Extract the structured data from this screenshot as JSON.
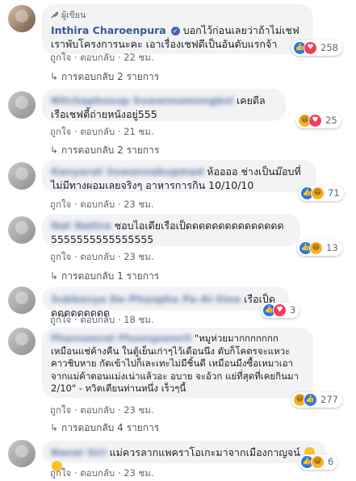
{
  "comments": [
    {
      "badge": "ผู้เขียน",
      "name": "Inthira Charoenpura",
      "text": "บอกไว้ก่อนเลยว่าถ้าไม่เชฟเราพับโครงการนะคะ เอาเรื่องเชฟดีเป็นอันดับแรกจ้า",
      "reactions": [
        "like",
        "love"
      ],
      "count": "258",
      "like_label": "ถูกใจ",
      "reply_label": "ตอบกลับ",
      "time": "22 ชม.",
      "replies_label": "การตอบกลับ 2 รายการ"
    },
    {
      "name": "Nitchaphosup Suwannamongkol",
      "text": "เคยดีลเรือเชฟตี้ถ่ายหนังอยู่555",
      "reactions": [
        "haha",
        "love"
      ],
      "count": "25",
      "like_label": "ถูกใจ",
      "reply_label": "ตอบกลับ",
      "time": "21 ชม.",
      "replies_label": "การตอบกลับ 2 รายการ"
    },
    {
      "name": "Kanyarat Suwannakupmad",
      "text": "ห้ออออ ช่างเป็นม๊อบที่ไม่มีทางผอมเลยจริงๆ อาหารการกิน 10/10/10",
      "reactions": [
        "like",
        "haha"
      ],
      "count": "71",
      "like_label": "ถูกใจ",
      "reply_label": "ตอบกลับ",
      "time": "23 ชม."
    },
    {
      "name": "Nat Nattra",
      "text": "ชอบไอเดียเรือเป็ดดดดดดดดดดดดดดด 5555555555555555",
      "reactions": [
        "like",
        "haha"
      ],
      "count": "13",
      "like_label": "ถูกใจ",
      "reply_label": "ตอบกลับ",
      "time": "23 ชม.",
      "replies_label": "การตอบกลับ 1 รายการ"
    },
    {
      "name": "Sukkanya De-Phanpha Pa-Ai-Sine",
      "text": "เรือเป็ดดดดดดดดดด",
      "reactions": [
        "like",
        "love"
      ],
      "count": "3",
      "like_label": "ถูกใจ",
      "reply_label": "ตอบกลับ",
      "time": "18 ชม."
    },
    {
      "name": "Phannamrat Phuengsamrit",
      "text": "\"หมูห่วยมากกกกกกก เหมือนแช่ค้างคืน ในตู้เย็นเก่าๆไว้เดือนนึง ตับก็โคตรจะแหวะ คาวชิบหาย กัดเข้าไปก็เละเทะไม่มีชิ้นดี เหมือนมีงซื้อเหมาเอาจากแม่ค้าตอนแม่งเน่าแล้วอะ อบาย จะอ้วก แย่ที่สุดที่เคยกินมา 2/10\" - ทวิตเตียนท่านหนึ่ง เร็วๆนี้",
      "reactions": [
        "haha",
        "like"
      ],
      "count": "277",
      "like_label": "ถูกใจ",
      "reply_label": "ตอบกลับ",
      "time": "23 ชม.",
      "replies_label": "การตอบกลับ 4 รายการ"
    },
    {
      "name": "Nanai Siri",
      "text": "แม่ควรลากแพคราโอเกะมาจากเมืองกาญจน์",
      "reactions": [
        "like",
        "haha"
      ],
      "count": "6",
      "like_label": "ถูกใจ",
      "reply_label": "ตอบกลับ",
      "time": "23 ชม."
    }
  ],
  "colors": {
    "link": "#385898",
    "bubble": "#f2f3f5",
    "meta": "#606770",
    "like": "#2078f4",
    "love": "#f33e58",
    "haha": "#f7b125"
  },
  "icons": {
    "author_badge": "feather-icon",
    "verified": "verified-check-icon",
    "replies": "reply-arrow-icon"
  }
}
